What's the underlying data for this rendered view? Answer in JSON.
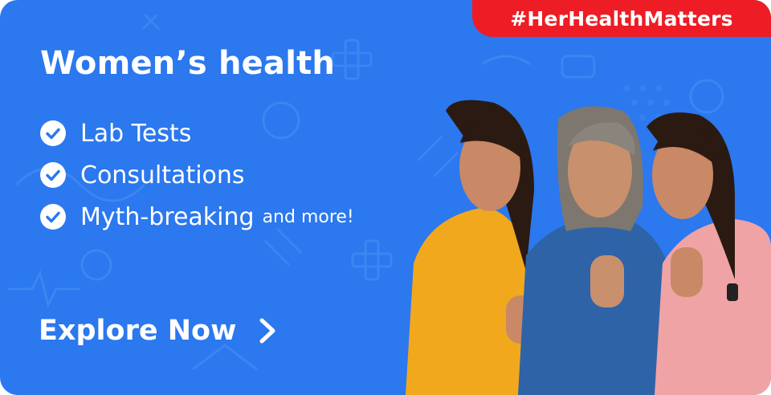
{
  "banner": {
    "hashtag": "#HerHealthMatters",
    "title": "Women’s health",
    "items": [
      {
        "label": "Lab Tests",
        "suffix": ""
      },
      {
        "label": "Consultations",
        "suffix": ""
      },
      {
        "label": "Myth-breaking",
        "suffix": "and more!"
      }
    ],
    "cta": "Explore Now"
  },
  "colors": {
    "background": "#2b78ef",
    "tag": "#ee1c25",
    "text": "#ffffff"
  },
  "icons": [
    "check-circle-icon",
    "chevron-right-icon"
  ]
}
